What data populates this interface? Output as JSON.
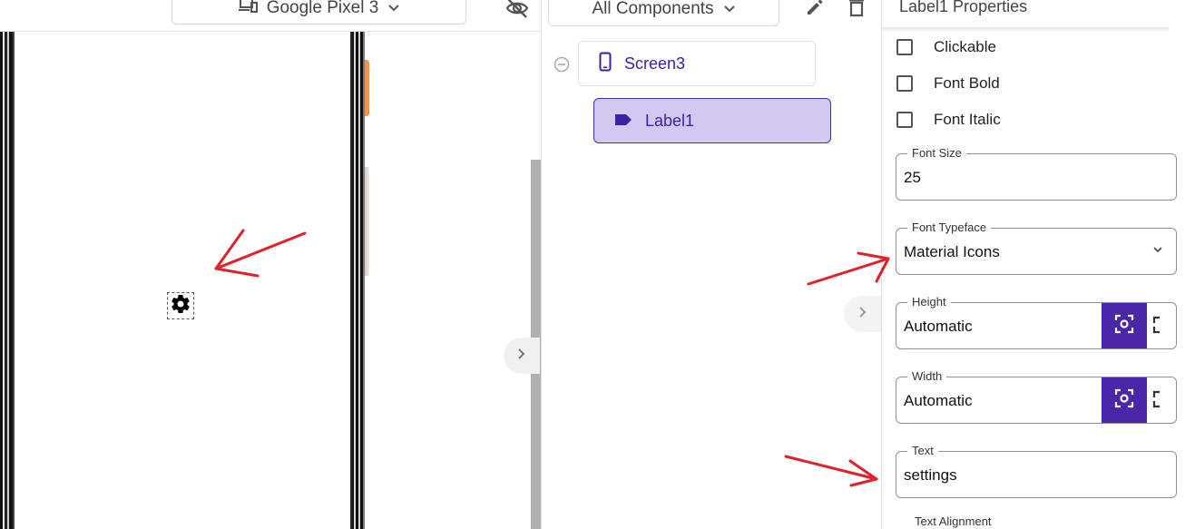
{
  "toolbar": {
    "device_label": "Google Pixel 3",
    "device_icon": "devices-icon",
    "visibility_icon": "eye-off-icon",
    "components_label": "All Components",
    "edit_icon": "pencil-icon",
    "delete_icon": "trash-icon"
  },
  "tree": {
    "screen": {
      "label": "Screen3",
      "icon": "phone-icon"
    },
    "label": {
      "label": "Label1",
      "icon": "label-icon",
      "selected": true
    }
  },
  "viewer": {
    "rendered_label_icon": "settings-gear-icon"
  },
  "properties": {
    "title": "Label1 Properties",
    "checkboxes": [
      {
        "label": "Clickable",
        "checked": false
      },
      {
        "label": "Font Bold",
        "checked": false
      },
      {
        "label": "Font Italic",
        "checked": false
      }
    ],
    "font_size": {
      "label": "Font Size",
      "value": "25"
    },
    "font_typeface": {
      "label": "Font Typeface",
      "value": "Material Icons"
    },
    "height": {
      "label": "Height",
      "value": "Automatic"
    },
    "width": {
      "label": "Width",
      "value": "Automatic"
    },
    "text": {
      "label": "Text",
      "value": "settings"
    },
    "text_alignment": {
      "label": "Text Alignment"
    }
  },
  "colors": {
    "accent": "#4a26a8",
    "selected_bg": "#d3c8f2",
    "annotation": "#e0202a"
  }
}
